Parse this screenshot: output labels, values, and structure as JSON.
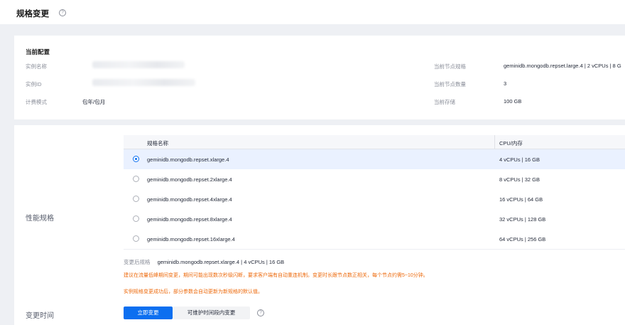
{
  "page": {
    "title": "规格变更"
  },
  "current_config": {
    "heading": "当前配置",
    "instance_name_label": "实例名称",
    "instance_id_label": "实例ID",
    "billing_label": "计费模式",
    "billing_value": "包年/包月",
    "node_spec_label": "当前节点规格",
    "node_spec_value": "geminidb.mongodb.repset.large.4 | 2 vCPUs | 8 G",
    "node_count_label": "当前节点数量",
    "node_count_value": "3",
    "storage_label": "当前存储",
    "storage_value": "100 GB"
  },
  "performance": {
    "section_label": "性能规格",
    "columns": {
      "name": "规格名称",
      "cpu": "CPU/内存"
    },
    "rows": [
      {
        "name": "geminidb.mongodb.repset.xlarge.4",
        "cpu": "4 vCPUs | 16 GB",
        "selected": true
      },
      {
        "name": "geminidb.mongodb.repset.2xlarge.4",
        "cpu": "8 vCPUs | 32 GB",
        "selected": false
      },
      {
        "name": "geminidb.mongodb.repset.4xlarge.4",
        "cpu": "16 vCPUs | 64 GB",
        "selected": false
      },
      {
        "name": "geminidb.mongodb.repset.8xlarge.4",
        "cpu": "32 vCPUs | 128 GB",
        "selected": false
      },
      {
        "name": "geminidb.mongodb.repset.16xlarge.4",
        "cpu": "64 vCPUs | 256 GB",
        "selected": false
      }
    ],
    "after_label": "变更后规格",
    "after_value": "geminidb.mongodb.repset.xlarge.4 | 4 vCPUs | 16 GB",
    "warning_1": "建议在流量低峰期间变更，期间可能出现数次秒级闪断，要求客户端有自动重连机制。变更时长跟节点数正相关，每个节点约需5~10分钟。",
    "warning_2": "实例规格变更成功后，部分参数会自动更新为新规格的默认值。"
  },
  "change_time": {
    "section_label": "变更时间",
    "immediate_label": "立即变更",
    "maintenance_label": "可维护时间段内变更"
  },
  "colors": {
    "primary": "#0c6ff0",
    "warning": "#ed6a0c",
    "selected_row": "#eaf1ff"
  },
  "icons": {
    "help": "question-circle-icon"
  }
}
